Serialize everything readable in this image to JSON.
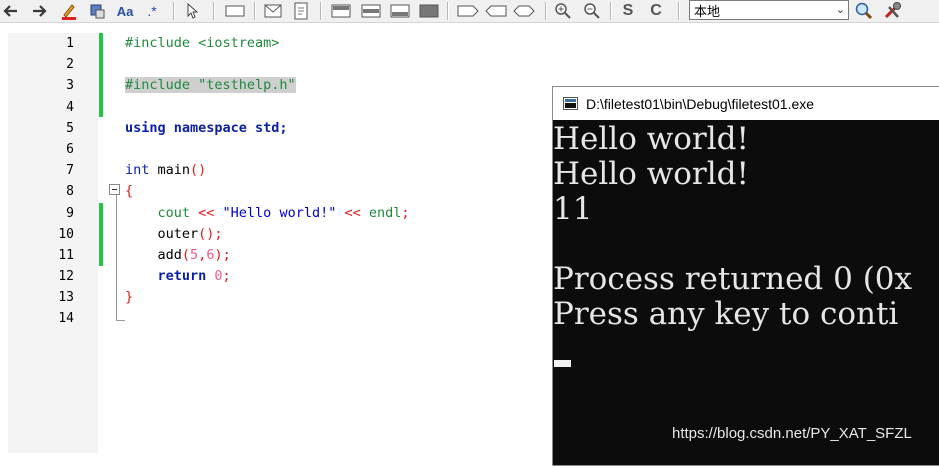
{
  "toolbar": {
    "buttons": [
      {
        "name": "back-arrow-icon"
      },
      {
        "name": "forward-arrow-icon"
      },
      {
        "name": "highlight-pen-icon"
      },
      {
        "name": "stamp-icon"
      },
      {
        "name": "font-icon",
        "text": "Aa"
      },
      {
        "name": "regex-icon",
        "text": ".*"
      },
      {
        "name": "select-cursor-icon"
      },
      {
        "name": "rectangle-icon"
      },
      {
        "name": "envelope-icon"
      },
      {
        "name": "document-icon"
      },
      {
        "name": "panel-top-icon"
      },
      {
        "name": "panel-middle-icon"
      },
      {
        "name": "panel-bottom-icon"
      },
      {
        "name": "panel-full-icon"
      },
      {
        "name": "tag-right-icon"
      },
      {
        "name": "tag-left-icon"
      },
      {
        "name": "tag-both-icon"
      },
      {
        "name": "zoom-in-icon"
      },
      {
        "name": "zoom-out-icon"
      },
      {
        "name": "strikethrough-s-icon",
        "text": "S"
      },
      {
        "name": "c-letter-icon",
        "text": "C"
      },
      {
        "name": "search-icon"
      },
      {
        "name": "tools-icon"
      }
    ],
    "scope_value": "本地"
  },
  "editor": {
    "line_numbers": [
      "1",
      "2",
      "3",
      "4",
      "5",
      "6",
      "7",
      "8",
      "9",
      "10",
      "11",
      "12",
      "13",
      "14"
    ],
    "lines": {
      "l1": "#include <iostream>",
      "l3": "#include \"testhelp.h\"",
      "l5_kw": "using namespace",
      "l5_rest": " std;",
      "l7_kw": "int",
      "l7_name": " main",
      "l7_paren": "()",
      "l8": "{",
      "l9_a": "    cout",
      "l9_op1": " << ",
      "l9_str": "\"Hello world!\"",
      "l9_op2": " << ",
      "l9_b": "endl",
      "l9_semi": ";",
      "l10_a": "    outer",
      "l10_p": "();",
      "l11_a": "    add",
      "l11_p1": "(",
      "l11_n1": "5",
      "l11_c": ",",
      "l11_n2": "6",
      "l11_p2": ");",
      "l12_kw": "    return",
      "l12_n": " 0",
      "l12_semi": ";",
      "l13": "}"
    }
  },
  "console": {
    "title": "D:\\filetest01\\bin\\Debug\\filetest01.exe",
    "output": [
      "Hello world!",
      "Hello world!",
      "11",
      "",
      "Process returned 0 (0x",
      "Press any key to conti"
    ]
  },
  "watermark": "https://blog.csdn.net/PY_XAT_SFZL",
  "colors": {
    "change_bar": "#21c841",
    "preprocessor": "#1f8a3e",
    "keyword": "#0a1fa8",
    "string": "#0000d8",
    "number": "#f25a8a",
    "operator": "#e01a1a",
    "console_bg": "#0c0c0c"
  }
}
